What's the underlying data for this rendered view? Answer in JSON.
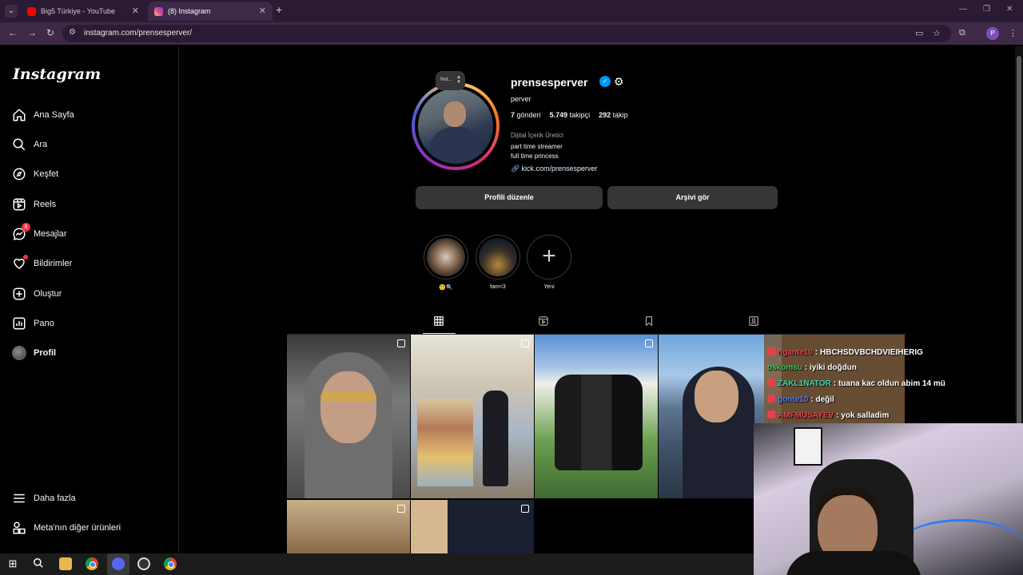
{
  "browser": {
    "tabs": [
      {
        "title": "Big5 Türkiye - YouTube"
      },
      {
        "title": "(8) Instagram"
      }
    ],
    "url": "instagram.com/prensesperver/",
    "profile_initial": "P"
  },
  "sidebar": {
    "logo": "Instagram",
    "items": [
      {
        "label": "Ana Sayfa",
        "icon": "home-icon"
      },
      {
        "label": "Ara",
        "icon": "search-icon"
      },
      {
        "label": "Keşfet",
        "icon": "compass-icon"
      },
      {
        "label": "Reels",
        "icon": "reels-icon"
      },
      {
        "label": "Mesajlar",
        "icon": "messenger-icon",
        "badge": "8"
      },
      {
        "label": "Bildirimler",
        "icon": "heart-icon"
      },
      {
        "label": "Oluştur",
        "icon": "plus-square-icon"
      },
      {
        "label": "Pano",
        "icon": "dashboard-icon"
      },
      {
        "label": "Profil",
        "icon": "avatar"
      }
    ],
    "more": "Daha fazla",
    "meta": "Meta'nın diğer ürünleri"
  },
  "profile": {
    "note": "Not...",
    "username": "prensesperver",
    "display_name": "perver",
    "posts": "7",
    "posts_label": "gönderi",
    "followers": "5.749",
    "followers_label": "takipçi",
    "following": "292",
    "following_label": "takip",
    "category": "Dijital İçerik Üretici",
    "bio_line1": "part time streamer",
    "bio_line2": "full time princess",
    "link": "kick.com/prensesperver",
    "edit_button": "Profili düzenle",
    "archive_button": "Arşivi gör"
  },
  "highlights": [
    {
      "caption": "😵‍💫🔍"
    },
    {
      "caption": "fam<3"
    },
    {
      "caption": "Yeni"
    }
  ],
  "tabs": [
    "posts-grid-icon",
    "reels-tab-icon",
    "saved-icon",
    "tagged-icon"
  ],
  "stream_chat": [
    {
      "user": "ngante10",
      "message": ": HBCHSDVBCHDVIEIHERIG",
      "color": "#e4424a"
    },
    {
      "user": "oskomsu",
      "message": ": iyiki doğdun",
      "color": "#3ec45a"
    },
    {
      "user": "ZAKL1NATOR",
      "message": ": tuana kac oldun abim 14 mü",
      "color": "#3fd6a8"
    },
    {
      "user": "gonte10",
      "message": ": değil",
      "color": "#4a7bff"
    },
    {
      "user": "AMFMUSAYEV",
      "message": ": yok salladim",
      "color": "#e4424a"
    }
  ]
}
